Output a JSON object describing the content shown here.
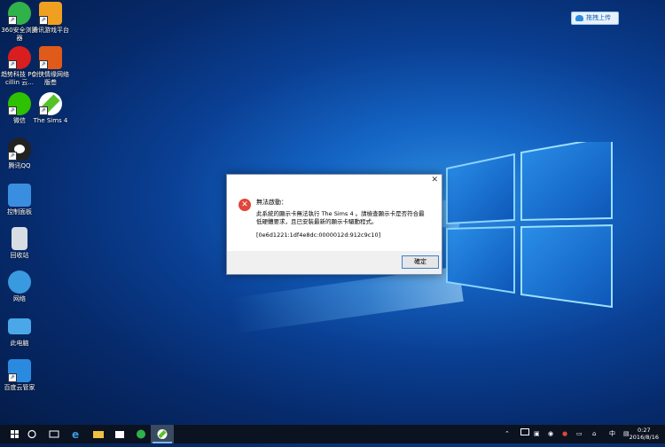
{
  "desktop": {
    "icons": [
      {
        "label": "360安全浏览器",
        "icon": "360-browser-icon",
        "color": "#2fb24a"
      },
      {
        "label": "腾讯游戏平台",
        "icon": "tencent-game-icon",
        "color": "#f0a020"
      },
      {
        "label": "趋势科技 PC-cillin 云...",
        "icon": "pc-cillin-icon",
        "color": "#d81e1e"
      },
      {
        "label": "剑侠情缘网络版叁",
        "icon": "jx3-icon",
        "color": "#e05a1a"
      },
      {
        "label": "微信",
        "icon": "wechat-icon",
        "color": "#2dc100"
      },
      {
        "label": "The Sims 4",
        "icon": "sims4-icon",
        "color": "#56c22a"
      },
      {
        "label": "腾讯QQ",
        "icon": "qq-icon",
        "color": "#222222"
      },
      {
        "label": "控制面板",
        "icon": "control-panel-icon",
        "color": "#3a8ee0"
      },
      {
        "label": "回收站",
        "icon": "recycle-bin-icon",
        "color": "#d8dde4"
      },
      {
        "label": "网络",
        "icon": "network-icon",
        "color": "#3a9ae0"
      },
      {
        "label": "此电脑",
        "icon": "this-pc-icon",
        "color": "#4aa8e8"
      },
      {
        "label": "百度云管家",
        "icon": "baidu-cloud-icon",
        "color": "#2a8ae0"
      }
    ],
    "upload_button": "拖拽上传"
  },
  "dialog": {
    "close": "✕",
    "title": "無法啟動：",
    "message": "此系統的顯示卡無法執行 The Sims 4 。請檢查顯示卡是否符合最低硬體要求，且已安裝最新的顯示卡驅動程式。",
    "code": "[0e6d1221:1df4e8dc:0000012d:912c9c10]",
    "ok_button": "確定"
  },
  "taskbar": {
    "clock_time": "0:27",
    "clock_date": "2016/8/16",
    "ime_label": "中"
  }
}
